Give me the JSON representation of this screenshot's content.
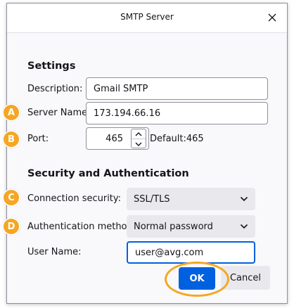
{
  "dialog": {
    "title": "SMTP Server"
  },
  "settings": {
    "heading": "Settings",
    "description": {
      "label": "Description:",
      "value": "Gmail SMTP"
    },
    "server_name": {
      "label": "Server Name:",
      "value": "173.194.66.16"
    },
    "port": {
      "label": "Port:",
      "value": "465",
      "default_text": "Default:465"
    }
  },
  "security": {
    "heading": "Security and Authentication",
    "connection_security": {
      "label": "Connection security:",
      "value": "SSL/TLS"
    },
    "auth_method": {
      "label": "Authentication method:",
      "value": "Normal password"
    },
    "user_name": {
      "label": "User Name:",
      "value": "user@avg.com"
    }
  },
  "buttons": {
    "ok": "OK",
    "cancel": "Cancel"
  },
  "markers": [
    "A",
    "B",
    "C",
    "D"
  ],
  "colors": {
    "accent": "#0061e0",
    "marker": "#f5a623"
  }
}
